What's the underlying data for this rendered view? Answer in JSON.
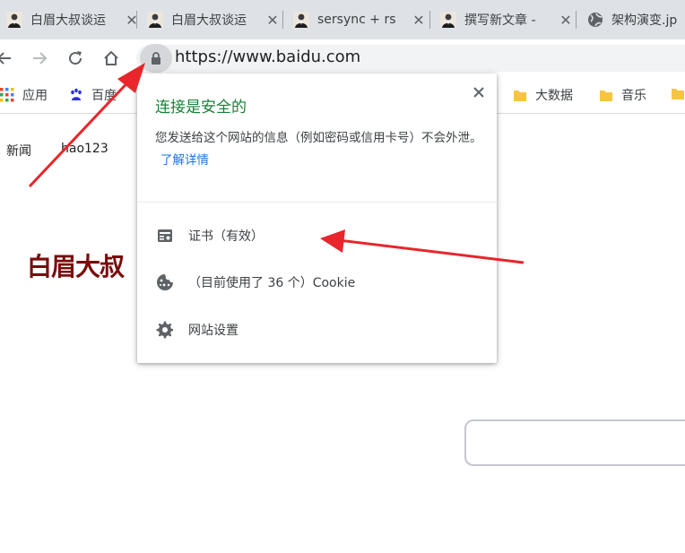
{
  "tabs": [
    {
      "title": "白眉大叔谈运",
      "icon": "profile-avatar-icon"
    },
    {
      "title": "白眉大叔谈运",
      "icon": "profile-avatar-icon"
    },
    {
      "title": "sersync + rs",
      "icon": "profile-avatar-icon"
    },
    {
      "title": "撰写新文章 -",
      "icon": "profile-avatar-icon"
    },
    {
      "title": "架构演变.jp",
      "icon": "globe-icon"
    }
  ],
  "toolbar": {
    "url": "https://www.baidu.com"
  },
  "bookmarks": {
    "items": [
      {
        "label": "应用",
        "icon": "apps-grid-icon"
      },
      {
        "label": "百度",
        "icon": "baidu-paw-icon"
      },
      {
        "label": "大数据",
        "icon": "folder-icon"
      },
      {
        "label": "音乐",
        "icon": "folder-icon"
      }
    ]
  },
  "page": {
    "links": [
      "新闻",
      "hao123"
    ]
  },
  "watermark": "白眉大叔",
  "site_info_popup": {
    "title": "连接是安全的",
    "description": "您发送给这个网站的信息（例如密码或信用卡号）不会外泄。",
    "learn_more": "了解详情",
    "certificate": "证书（有效）",
    "cookies": "（目前使用了 36 个）Cookie",
    "site_settings": "网站设置"
  },
  "colors": {
    "secure_green": "#188038",
    "link_blue": "#1a73e8",
    "annotation_red": "#e8262b",
    "watermark_red": "#7a0c0c"
  }
}
